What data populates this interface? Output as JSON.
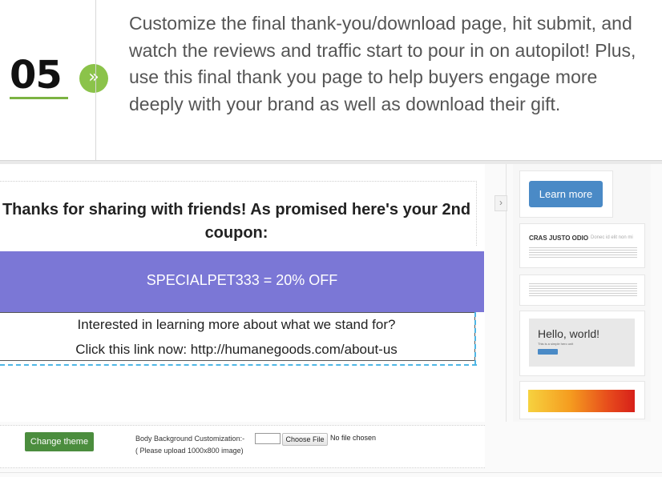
{
  "step": {
    "number": "05",
    "arrow_icon": "»",
    "text": "Customize the final thank-you/download page, hit submit, and watch the reviews and traffic start to pour in on autopilot! Plus, use this final thank you page to help buyers engage more deeply with your brand as well as download their gift."
  },
  "canvas": {
    "thanks_text": "Thanks for sharing with friends! As promised here's your 2nd coupon:",
    "coupon_text": "SPECIALPET333 = 20% OFF",
    "interest_line1": "Interested in learning more about what we stand for?",
    "interest_line2": "Click this link now: http://humanegoods.com/about-us"
  },
  "panel": {
    "toggle_icon": "›",
    "learn_more_label": "Learn more",
    "cras_title": "CRAS JUSTO ODIO",
    "cras_sub": "Donec id elit non mi",
    "hello_title": "Hello, world!",
    "hello_sub": "This is a simple hero unit"
  },
  "bottom": {
    "change_theme_label": "Change theme",
    "bg_label": "Body Background Customization:-",
    "bg_note": "( Please upload 1000x800 image)",
    "choose_file_label": "Choose File",
    "no_file_text": "No file chosen"
  },
  "colors": {
    "accent_green": "#8bc34a",
    "coupon_purple": "#7b77d6",
    "button_blue": "#4a8ac6",
    "theme_green": "#4b8d3e"
  }
}
